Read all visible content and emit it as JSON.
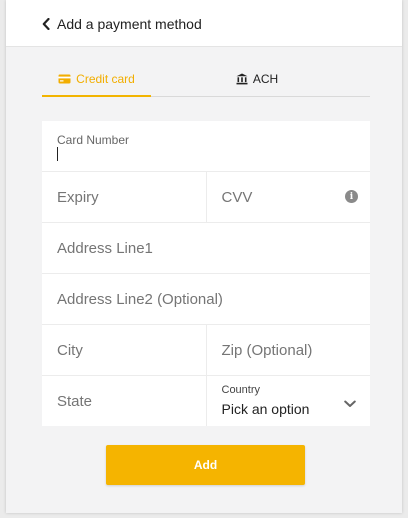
{
  "header": {
    "title": "Add a payment method",
    "back_icon": "chevron-left-icon"
  },
  "tabs": [
    {
      "label": "Credit card",
      "icon": "credit-card-icon",
      "active": true
    },
    {
      "label": "ACH",
      "icon": "bank-icon",
      "active": false
    }
  ],
  "form": {
    "card_number": {
      "label": "Card Number",
      "value": ""
    },
    "expiry": {
      "placeholder": "Expiry"
    },
    "cvv": {
      "placeholder": "CVV",
      "info_icon": "info-icon"
    },
    "address_line1": {
      "placeholder": "Address Line1"
    },
    "address_line2": {
      "placeholder": "Address Line2 (Optional)"
    },
    "city": {
      "placeholder": "City"
    },
    "zip": {
      "placeholder": "Zip (Optional)"
    },
    "state": {
      "placeholder": "State"
    },
    "country": {
      "label": "Country",
      "value": "Pick an option",
      "icon": "chevron-down-icon"
    }
  },
  "actions": {
    "add_label": "Add"
  },
  "colors": {
    "accent": "#f5b400",
    "active_tab_text": "#f2ae00"
  }
}
